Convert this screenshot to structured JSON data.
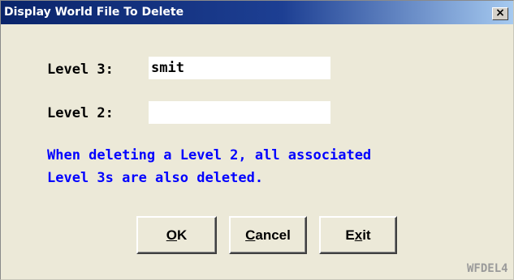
{
  "window": {
    "title": "Display World File To Delete",
    "close_glyph": "×",
    "close_icon": "close-icon"
  },
  "form": {
    "level3_label": "Level 3:",
    "level3_value": "smit",
    "level2_label": "Level 2:",
    "level2_value": ""
  },
  "note": {
    "line1": "When deleting a Level 2, all associated",
    "line2": "Level 3s are also deleted."
  },
  "buttons": {
    "ok_mnemonic": "O",
    "ok_rest": "K",
    "cancel_mnemonic": "C",
    "cancel_rest": "ancel",
    "exit_first": "E",
    "exit_mnemonic": "x",
    "exit_rest": "it"
  },
  "form_id": "WFDEL4",
  "colors": {
    "title_bar": "#0a246a",
    "note_text": "#0000ff",
    "dialog_bg": "#ece9d8"
  }
}
